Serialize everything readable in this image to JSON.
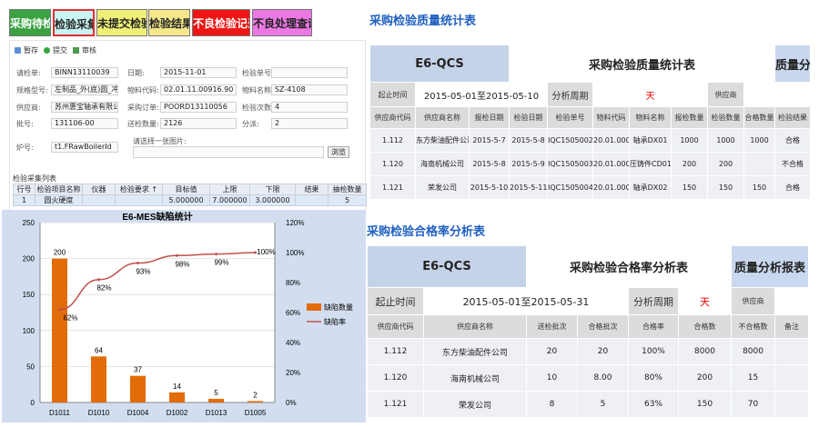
{
  "toolbar_buttons": [
    {
      "label": "采购待检",
      "bg": "#3aa241",
      "color": "#ffffff"
    },
    {
      "label": "检验采集",
      "bg": "#c9f5f5",
      "color": "#222222"
    },
    {
      "label": "未提交检验",
      "bg": "#f0f078",
      "color": "#222222"
    },
    {
      "label": "检验结果",
      "bg": "#f5e88a",
      "color": "#222222"
    },
    {
      "label": "不良检验记录",
      "bg": "#ee1515",
      "color": "#ffffff"
    },
    {
      "label": "不良处理查询",
      "bg": "#ec78e4",
      "color": "#222222"
    }
  ],
  "form": {
    "toolbar": [
      {
        "label": "暂存"
      },
      {
        "label": "提交"
      },
      {
        "label": "审核"
      }
    ],
    "fields": [
      {
        "label": "请检单:",
        "value": "BINN13110039"
      },
      {
        "label": "日期:",
        "value": "2015-11-01"
      },
      {
        "label": "检验单号:",
        "value": ""
      },
      {
        "label": "规格型号:",
        "value": "左制品_外(底)圆_冲压成形_5"
      },
      {
        "label": "物料代码:",
        "value": "02.01.11.00916.90"
      },
      {
        "label": "物料名称:",
        "value": "SZ-4108"
      },
      {
        "label": "供应商:",
        "value": "苏州惠宝轴承有限公司"
      },
      {
        "label": "采购订单:",
        "value": "POORD13110056"
      },
      {
        "label": "检验次数:",
        "value": "4"
      },
      {
        "label": "批号:",
        "value": "131106-00"
      },
      {
        "label": "送检数量:",
        "value": "2126"
      },
      {
        "label": "分派:",
        "value": "2"
      },
      {
        "label": "炉号:",
        "value": "t1.FRawBoilerId"
      }
    ],
    "image_label": "请选择一张图片:",
    "browse_label": "浏览",
    "list_title": "检验采集列表",
    "list_headers": [
      "行号",
      "检验项目名称",
      "仪器",
      "检验要求 ↑",
      "目标值",
      "上限",
      "下限",
      "结果",
      "抽检数量"
    ],
    "list_rows": [
      [
        "1",
        "圆火硬度",
        "",
        "",
        "5.000000",
        "7.000000",
        "3.000000",
        "",
        "5"
      ]
    ]
  },
  "quality": {
    "header": "采购检验质量统计表",
    "brand": "E6-QCS",
    "title": "采购检验质量统计表",
    "report": "质量分析报表",
    "period_label": "起止时间",
    "period_value": "2015-05-01至2015-05-10",
    "cycle_label": "分析周期",
    "cycle_value": "天",
    "supplier_label": "供应商",
    "headers": [
      "供应商代码",
      "供应商名称",
      "报检日期",
      "检验日期",
      "检验单号",
      "物料代码",
      "物料名称",
      "报检数量",
      "检验数量",
      "合格数量",
      "检验结果"
    ],
    "rows": [
      [
        "1.112",
        "东方柴油配件公司",
        "2015-5-7",
        "2015-5-8",
        "IQC1505002",
        "20.01.0001",
        "轴承DX01",
        "1000",
        "1000",
        "1000",
        "合格"
      ],
      [
        "1.120",
        "海南机械公司",
        "2015-5-8",
        "2015-5-9",
        "IQC1505003",
        "20.01.0004",
        "压铸件CD01",
        "200",
        "200",
        "",
        "不合格"
      ],
      [
        "1.121",
        "荣发公司",
        "2015-5-10",
        "2015-5-11",
        "IQC1505004",
        "20.01.0007",
        "轴承DX02",
        "150",
        "150",
        "150",
        "合格"
      ]
    ]
  },
  "pass_rate": {
    "header": "采购检验合格率分析表",
    "brand": "E6-QCS",
    "title": "采购检验合格率分析表",
    "report": "质量分析报表",
    "period_label": "起止时间",
    "period_value": "2015-05-01至2015-05-31",
    "cycle_label": "分析周期",
    "cycle_value": "天",
    "supplier_label": "供应商",
    "headers": [
      "供应商代码",
      "供应商名称",
      "送检批次",
      "合格批次",
      "合格率",
      "合格数",
      "不合格数",
      "备注"
    ],
    "rows": [
      [
        "1.112",
        "东方柴油配件公司",
        "20",
        "20",
        "100%",
        "8000",
        "8000",
        ""
      ],
      [
        "1.120",
        "海南机械公司",
        "10",
        "8.00",
        "80%",
        "200",
        "15",
        ""
      ],
      [
        "1.121",
        "荣发公司",
        "8",
        "5",
        "63%",
        "150",
        "70",
        ""
      ]
    ]
  },
  "chart_data": {
    "type": "bar",
    "title": "E6-MES缺陷统计",
    "categories": [
      "D1011",
      "D1010",
      "D1004",
      "D1002",
      "D1013",
      "D1005"
    ],
    "series": [
      {
        "name": "缺陷数量",
        "values": [
          200,
          64,
          37,
          14,
          5,
          2
        ],
        "color": "#e36c0a"
      },
      {
        "name": "缺陷率",
        "values": [
          62,
          82,
          93,
          98,
          99,
          100
        ],
        "color": "#c0504d",
        "axis": "right"
      }
    ],
    "data_labels": [
      "200",
      "64",
      "37",
      "14",
      "5",
      "2"
    ],
    "rate_labels": [
      "62%",
      "82%",
      "93%",
      "98%",
      "99%",
      "100%"
    ],
    "left_ticks": [
      "0",
      "50",
      "100",
      "150",
      "200",
      "250"
    ],
    "right_ticks": [
      "0%",
      "20%",
      "40%",
      "60%",
      "80%",
      "100%",
      "120%"
    ],
    "ylim": [
      0,
      250
    ],
    "y2lim": [
      0,
      120
    ],
    "legend": "right"
  }
}
